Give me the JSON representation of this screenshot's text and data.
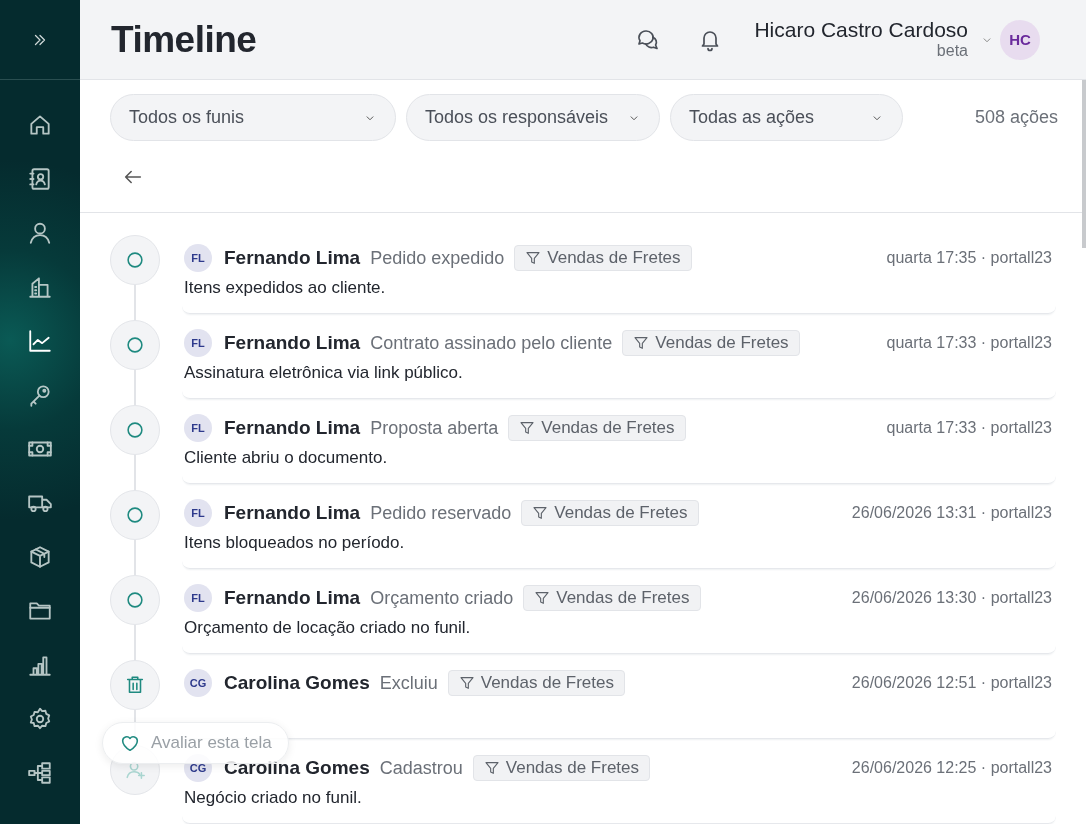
{
  "sidebar": {
    "items": [
      {
        "selected": false
      },
      {
        "selected": false
      },
      {
        "selected": false
      },
      {
        "selected": false
      },
      {
        "selected": true
      },
      {
        "selected": false
      },
      {
        "selected": false
      },
      {
        "selected": false
      },
      {
        "selected": false
      },
      {
        "selected": false
      },
      {
        "selected": false
      },
      {
        "selected": false
      },
      {
        "selected": false
      }
    ]
  },
  "header": {
    "title": "Timeline",
    "user": {
      "name": "Hicaro Castro Cardoso",
      "role": "beta",
      "initials": "HC"
    }
  },
  "filters": [
    {
      "label": "Todos os funis"
    },
    {
      "label": "Todos os responsáveis"
    },
    {
      "label": "Todas as ações"
    }
  ],
  "count": "508 ações",
  "events": [
    {
      "kind": "circle",
      "initials": "FL",
      "name": "Fernando Lima",
      "action": "Pedido expedido",
      "tag": "Vendas de Fretes",
      "time": "quarta 17:35 · portall23",
      "description": "Itens expedidos ao cliente."
    },
    {
      "kind": "circle",
      "initials": "FL",
      "name": "Fernando Lima",
      "action": "Contrato assinado pelo cliente",
      "tag": "Vendas de Fretes",
      "time": "quarta 17:33 · portall23",
      "description": "Assinatura eletrônica via link público."
    },
    {
      "kind": "circle",
      "initials": "FL",
      "name": "Fernando Lima",
      "action": "Proposta aberta",
      "tag": "Vendas de Fretes",
      "time": "quarta 17:33 · portall23",
      "description": "Cliente abriu o documento."
    },
    {
      "kind": "circle",
      "initials": "FL",
      "name": "Fernando Lima",
      "action": "Pedido reservado",
      "tag": "Vendas de Fretes",
      "time": "26/06/2026 13:31 · portall23",
      "description": "Itens bloqueados no período."
    },
    {
      "kind": "circle",
      "initials": "FL",
      "name": "Fernando Lima",
      "action": "Orçamento criado",
      "tag": "Vendas de Fretes",
      "time": "26/06/2026 13:30 · portall23",
      "description": "Orçamento de locação criado no funil."
    },
    {
      "kind": "trash",
      "initials": "CG",
      "name": "Carolina Gomes",
      "action": "Excluiu",
      "tag": "Vendas de Fretes",
      "time": "26/06/2026 12:51 · portall23"
    },
    {
      "kind": "user-plus",
      "initials": "CG",
      "name": "Carolina Gomes",
      "action": "Cadastrou",
      "tag": "Vendas de Fretes",
      "time": "26/06/2026 12:25 · portall23",
      "description": "Negócio criado no funil."
    }
  ],
  "feedback_button": {
    "label": "Avaliar esta tela"
  }
}
